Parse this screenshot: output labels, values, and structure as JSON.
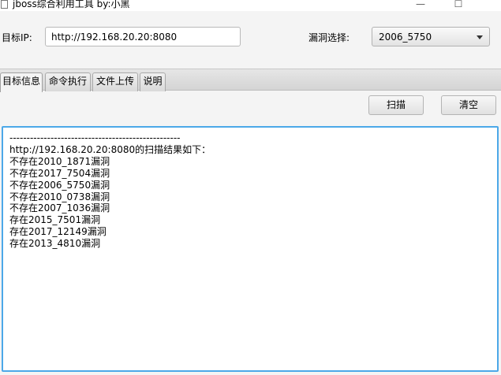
{
  "window": {
    "title": "jboss综合利用工具  by:小黑",
    "minimize_glyph": "—",
    "maximize_glyph": "☐"
  },
  "form": {
    "target_label": "目标IP:",
    "target_value": "http://192.168.20.20:8080",
    "vuln_label": "漏洞选择:",
    "vuln_selected": "2006_5750"
  },
  "tabs": [
    {
      "label": "目标信息",
      "active": true
    },
    {
      "label": "命令执行",
      "active": false
    },
    {
      "label": "文件上传",
      "active": false
    },
    {
      "label": "说明",
      "active": false
    }
  ],
  "actions": {
    "scan_label": "扫描",
    "clear_label": "清空"
  },
  "output": {
    "lines": [
      "--------------------------------------------------",
      "http://192.168.20.20:8080的扫描结果如下：",
      "不存在2010_1871漏洞",
      "不存在2017_7504漏洞",
      "不存在2006_5750漏洞",
      "不存在2010_0738漏洞",
      "不存在2007_1036漏洞",
      "存在2015_7501漏洞",
      "存在2017_12149漏洞",
      "存在2013_4810漏洞"
    ]
  }
}
